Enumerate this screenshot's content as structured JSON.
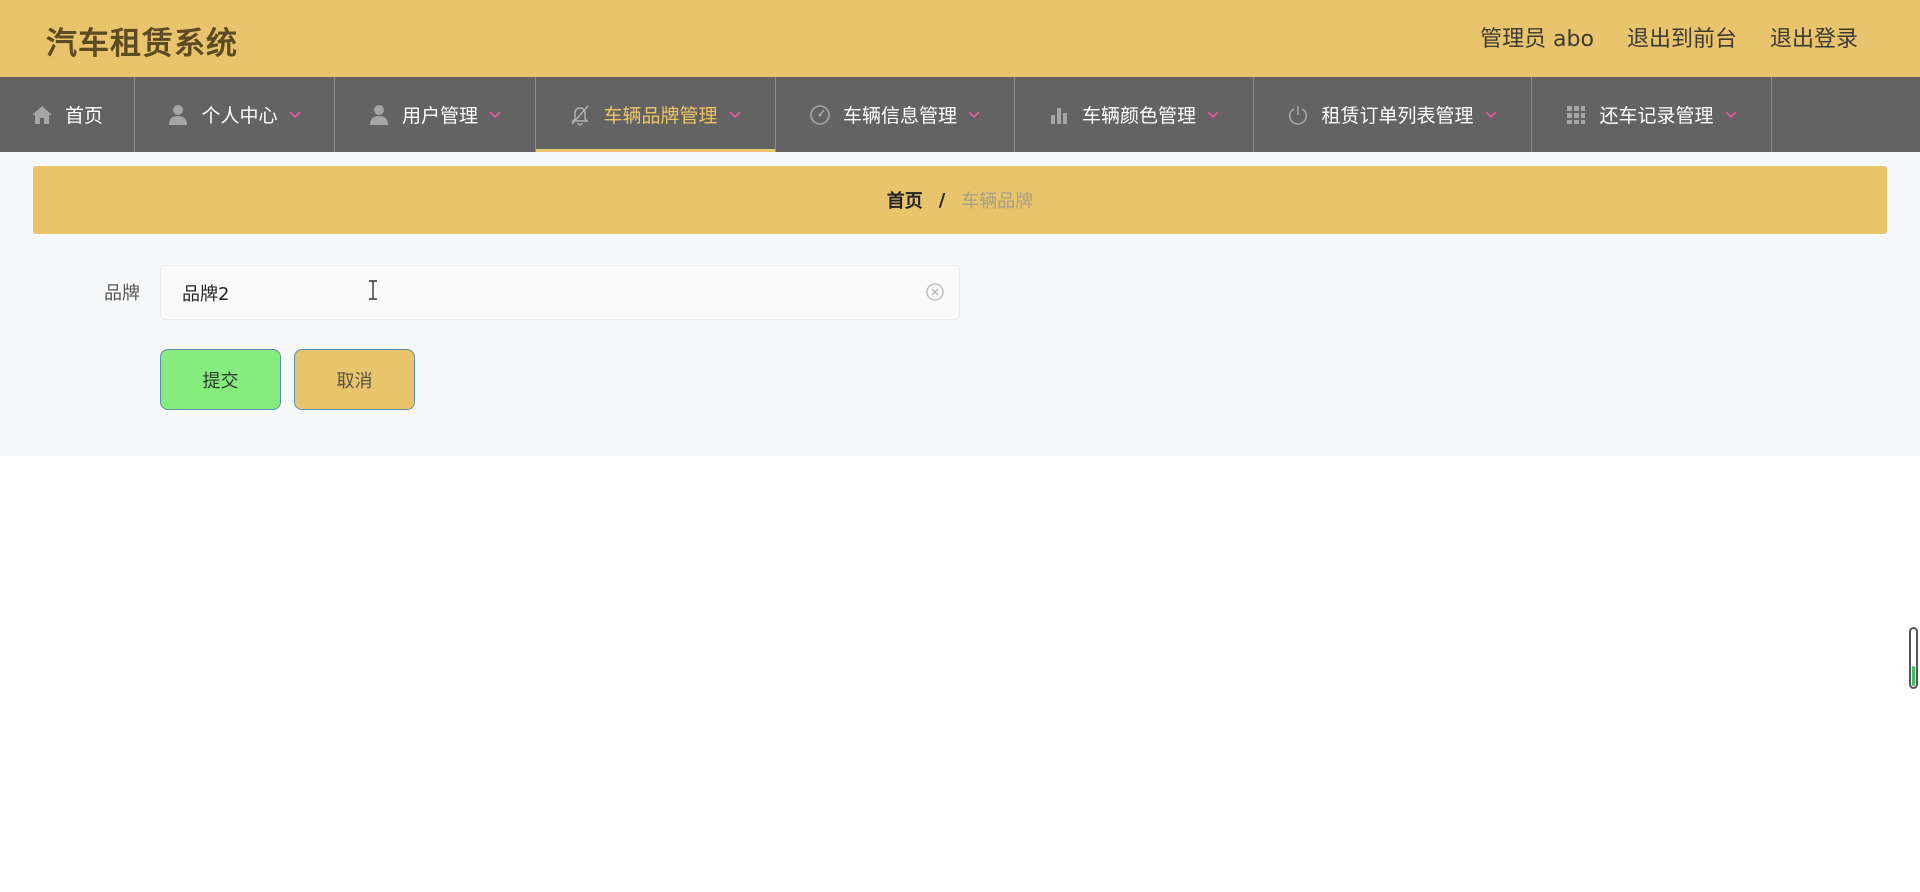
{
  "header": {
    "app_title": "汽车租赁系统",
    "user_label": "管理员 abo",
    "to_front_label": "退出到前台",
    "logout_label": "退出登录",
    "bg_color": "#e8c46d"
  },
  "nav": {
    "items": [
      {
        "label": "首页",
        "icon": "home-icon"
      },
      {
        "label": "个人中心",
        "icon": "user-icon"
      },
      {
        "label": "用户管理",
        "icon": "user-icon"
      },
      {
        "label": "车辆品牌管理",
        "icon": "bell-off-icon",
        "active": true
      },
      {
        "label": "车辆信息管理",
        "icon": "gauge-icon"
      },
      {
        "label": "车辆颜色管理",
        "icon": "bar-chart-icon"
      },
      {
        "label": "租赁订单列表管理",
        "icon": "power-icon"
      },
      {
        "label": "还车记录管理",
        "icon": "grid-icon"
      }
    ],
    "bg_color": "#636363",
    "active_color": "#f0c565",
    "chevron_color": "#e85aa0"
  },
  "breadcrumb": {
    "home": "首页",
    "separator": "/",
    "current": "车辆品牌"
  },
  "form": {
    "brand_label": "品牌",
    "brand_value": "品牌2",
    "submit_label": "提交",
    "cancel_label": "取消",
    "submit_color": "#86ec7d",
    "cancel_color": "#e8c46d"
  }
}
